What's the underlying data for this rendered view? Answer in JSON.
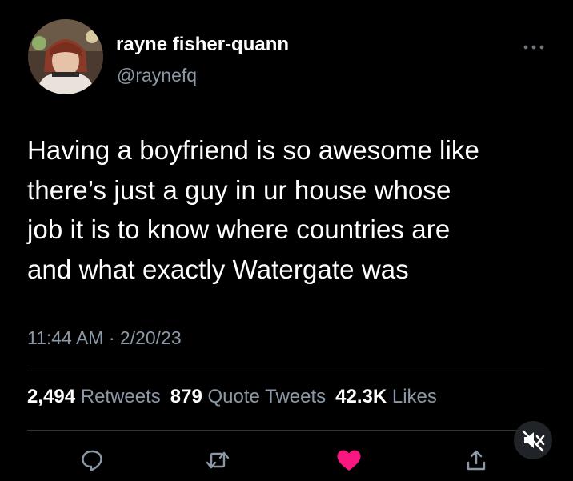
{
  "user": {
    "display_name": "rayne fisher-quann",
    "handle": "@raynefq"
  },
  "tweet": {
    "lines": [
      "Having a boyfriend is so awesome like",
      "there’s just a guy in ur house whose",
      "job it is to know where countries are",
      "and what exactly Watergate was"
    ],
    "timestamp": "11:44 AM · 2/20/23"
  },
  "stats": {
    "retweets_count": "2,494",
    "retweets_label": "Retweets",
    "quotes_count": "879",
    "quotes_label": "Quote Tweets",
    "likes_count": "42.3K",
    "likes_label": "Likes"
  },
  "icons": {
    "more": "more-options-icon",
    "reply": "reply-icon",
    "retweet": "retweet-icon",
    "like": "heart-icon",
    "share": "share-icon",
    "mute": "muted-speaker-icon"
  },
  "colors": {
    "background": "#000000",
    "text_primary": "#ffffff",
    "text_secondary": "#8b98a5",
    "like_pink": "#f91880",
    "divider": "#2f3336"
  }
}
